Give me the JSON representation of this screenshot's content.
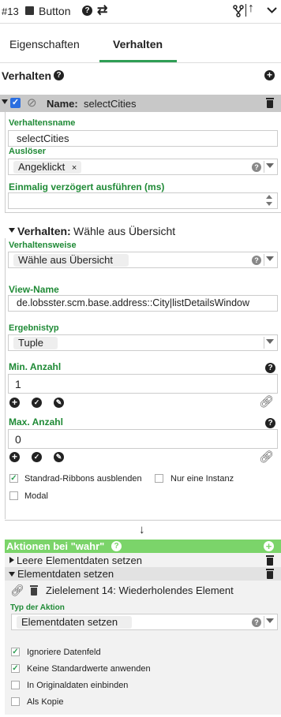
{
  "header": {
    "id_label": "#13",
    "component_label": "Button",
    "help_icon": "help-circle-icon",
    "swap_icon": "swap-arrows-icon",
    "branch_icon": "branch-icon",
    "up_icon": "arrow-up-icon",
    "chevron_icon": "chevron-down-icon"
  },
  "tabs": [
    {
      "label": "Eigenschaften",
      "active": false
    },
    {
      "label": "Verhalten",
      "active": true
    }
  ],
  "section": {
    "title": "Verhalten",
    "add_icon": "plus-circle-icon"
  },
  "behavior": {
    "enabled": true,
    "name_prefix": "Name:",
    "name_value": "selectCities",
    "name_label": "Verhaltensname",
    "name_field": "selectCities",
    "trigger_label": "Auslöser",
    "trigger_chip": "Angeklickt",
    "trigger_chip_remove": "×",
    "delay_label": "Einmalig verzögert ausführen (ms)",
    "delay_value": ""
  },
  "subbehavior": {
    "title_prefix": "Verhalten:",
    "title_value": "Wähle aus Übersicht",
    "mode_label": "Verhaltensweise",
    "mode_value": "Wähle aus Übersicht",
    "view_label": "View-Name",
    "view_value": "de.lobsster.scm.base.address::City|listDetailsWindow",
    "result_label": "Ergebnistyp",
    "result_value": "Tuple",
    "min_label": "Min. Anzahl",
    "min_value": "1",
    "max_label": "Max. Anzahl",
    "max_value": "0",
    "opt_ribbons_label": "Standrad-Ribbons ausblenden",
    "opt_ribbons_checked": true,
    "opt_single_label": "Nur eine Instanz",
    "opt_single_checked": false,
    "opt_modal_label": "Modal",
    "opt_modal_checked": false
  },
  "actions": {
    "arrow": "↓",
    "header_label": "Aktionen bei \"wahr\"",
    "item1_label": "Leere Elementdaten setzen",
    "item2_label": "Elementdaten setzen",
    "target_label": "Zielelement 14: Wiederholendes Element",
    "action_type_label": "Typ der Aktion",
    "action_type_value": "Elementdaten setzen",
    "opt_ignore_label": "Ignoriere Datenfeld",
    "opt_ignore_checked": true,
    "opt_nodefault_label": "Keine Standardwerte anwenden",
    "opt_nodefault_checked": true,
    "opt_original_label": "In Originaldaten einbinden",
    "opt_original_checked": false,
    "opt_copy_label": "Als Kopie",
    "opt_copy_checked": false
  },
  "colors": {
    "accent": "#2f9e55",
    "green_bar": "#7bd46a",
    "label_green": "#1f8a36",
    "row_gray": "#c8c8c8",
    "panel_gray": "#f2f2f2"
  }
}
